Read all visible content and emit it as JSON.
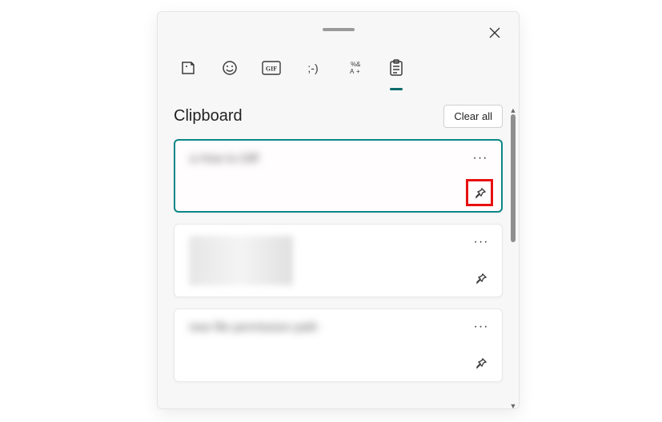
{
  "header": {
    "section_title": "Clipboard",
    "clear_all_label": "Clear all"
  },
  "tabs": {
    "sticker": "sticker",
    "emoji": "emoji",
    "gif": "GIF",
    "kaomoji": ";-)",
    "symbols": "symbols",
    "clipboard": "clipboard"
  },
  "cards": [
    {
      "preview": "a How to Diff",
      "type": "text"
    },
    {
      "preview": "image",
      "type": "image"
    },
    {
      "preview": "new file permission path",
      "type": "text"
    }
  ],
  "icons": {
    "more": "···"
  }
}
